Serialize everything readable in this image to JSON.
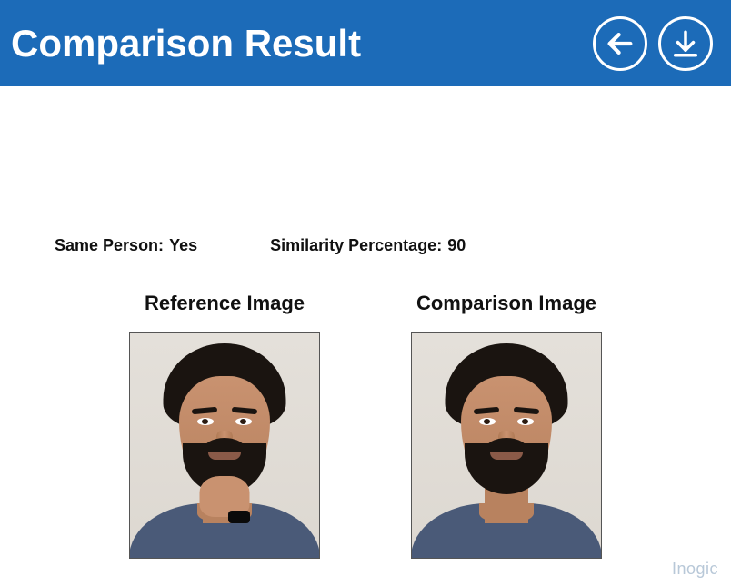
{
  "header": {
    "title": "Comparison Result"
  },
  "result": {
    "same_person_label": "Same Person:",
    "same_person_value": "Yes",
    "similarity_label": "Similarity Percentage:",
    "similarity_value": "90"
  },
  "images": {
    "reference_title": "Reference Image",
    "comparison_title": "Comparison Image"
  },
  "watermark": "Inogic"
}
